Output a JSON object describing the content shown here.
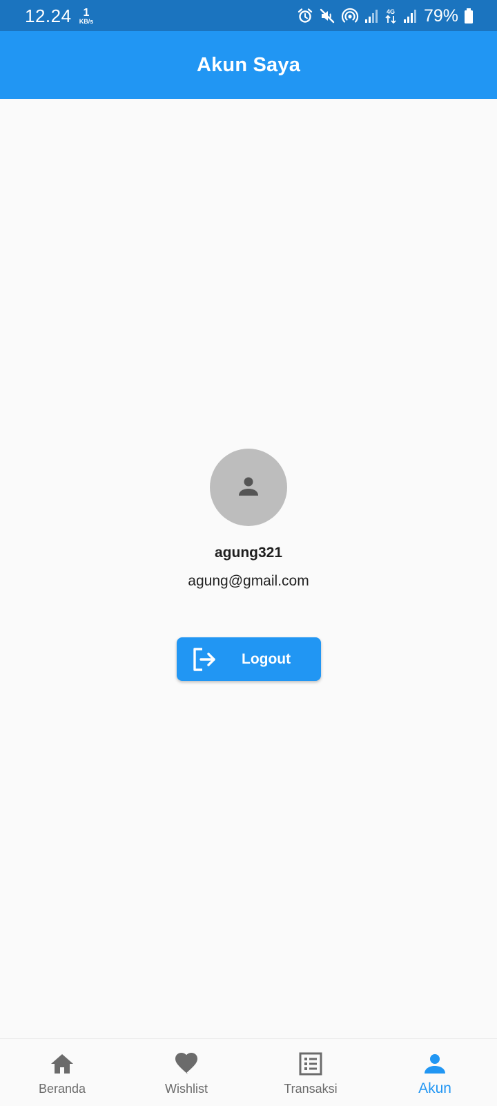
{
  "status_bar": {
    "time": "12.24",
    "speed_value": "1",
    "speed_unit": "KB/s",
    "battery": "79%",
    "icons": [
      "alarm-icon",
      "mute-icon",
      "hotspot-icon",
      "signal-icon",
      "4g-icon",
      "signal-icon",
      "battery-icon"
    ]
  },
  "app_bar": {
    "title": "Akun Saya"
  },
  "profile": {
    "avatar_icon": "person-icon",
    "username": "agung321",
    "email": "agung@gmail.com"
  },
  "logout": {
    "label": "Logout",
    "icon": "logout-icon"
  },
  "bottom_nav": {
    "items": [
      {
        "label": "Beranda",
        "icon": "home-icon",
        "active": false
      },
      {
        "label": "Wishlist",
        "icon": "heart-icon",
        "active": false
      },
      {
        "label": "Transaksi",
        "icon": "receipt-list-icon",
        "active": false
      },
      {
        "label": "Akun",
        "icon": "person-icon",
        "active": true
      }
    ]
  },
  "colors": {
    "primary": "#2196f3",
    "status_bar": "#1b74bf",
    "background": "#fafafa",
    "inactive": "#6b6b6b",
    "avatar_bg": "#bdbdbd"
  }
}
